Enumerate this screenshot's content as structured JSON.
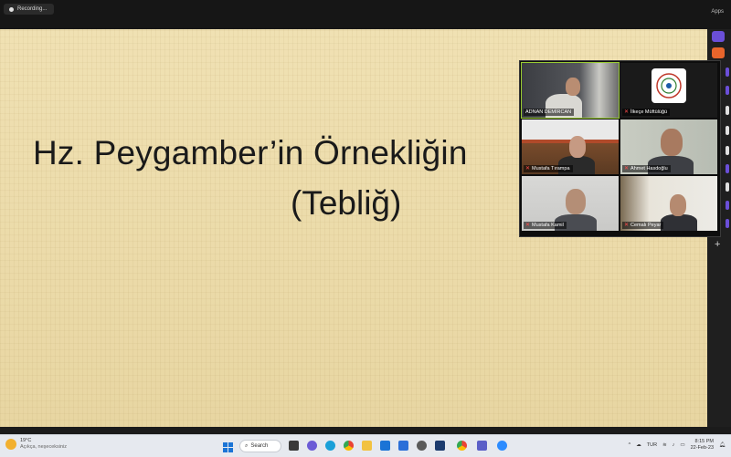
{
  "top_bar": {
    "recording_label": "Recording...",
    "apps_label": "Apps"
  },
  "slide": {
    "title_line1": "Hz. Peygamber’in Örnekliğin",
    "title_line2": "(Tebliğ)"
  },
  "participants": [
    {
      "name": "ADNAN DEMİRCAN",
      "muted": false,
      "active_speaker": true,
      "icon": "person-video"
    },
    {
      "name": "İlkeçe Müftülüğü",
      "muted": true,
      "icon": "logo-emblem"
    },
    {
      "name": "Mustafa Tırampa",
      "muted": true,
      "icon": "person-video"
    },
    {
      "name": "Ahmet Hasdoğlu",
      "muted": true,
      "icon": "person-video"
    },
    {
      "name": "Mustafa Kamil",
      "muted": true,
      "icon": "person-video"
    },
    {
      "name": "Cemalı Peyar",
      "muted": true,
      "icon": "person-video"
    }
  ],
  "side_strip": {
    "add_label": "+"
  },
  "taskbar": {
    "weather_temp": "19°C",
    "weather_desc": "Açıkça, neşeceksiniz",
    "search_label": "Search",
    "language": "TUR",
    "time": "8:15 PM",
    "date": "22-Feb-23"
  },
  "colors": {
    "slide_bg": "#eddcaa",
    "active_border": "#9acd32",
    "mute_icon": "#ff4a4a",
    "taskbar_bg": "#e6e9ef"
  }
}
